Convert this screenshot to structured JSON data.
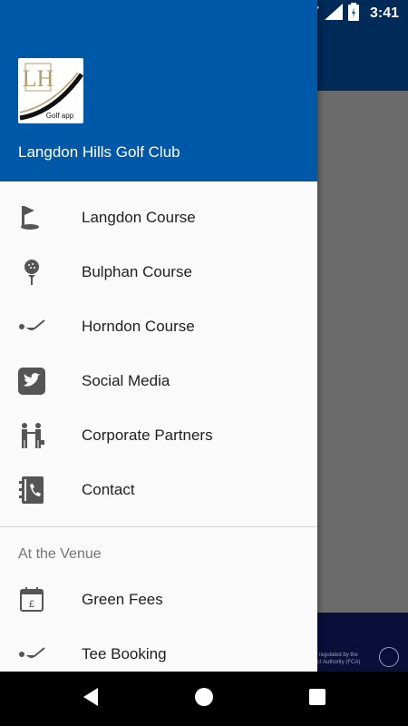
{
  "status_bar": {
    "time": "3:41"
  },
  "drawer": {
    "logo": {
      "monogram": "LH",
      "caption": "Golf app"
    },
    "club_name": "Langdon Hills Golf Club",
    "items": [
      {
        "label": "Langdon Course",
        "icon": "golf-flag-icon"
      },
      {
        "label": "Bulphan Course",
        "icon": "golf-ball-tee-icon"
      },
      {
        "label": "Horndon Course",
        "icon": "golf-club-ball-icon"
      },
      {
        "label": "Social Media",
        "icon": "twitter-icon"
      },
      {
        "label": "Corporate Partners",
        "icon": "handshake-people-icon"
      },
      {
        "label": "Contact",
        "icon": "phone-book-icon"
      }
    ],
    "section_title": "At the Venue",
    "venue_items": [
      {
        "label": "Green Fees",
        "icon": "calendar-pound-icon"
      },
      {
        "label": "Tee Booking",
        "icon": "golf-club-ball-icon"
      }
    ]
  },
  "background": {
    "footer_text": "and regulated by the\nnduct Authority (FCA)"
  },
  "colors": {
    "header": "#0058a8",
    "toolbar_behind": "#002a57",
    "scrim": "#6b6b6b"
  }
}
